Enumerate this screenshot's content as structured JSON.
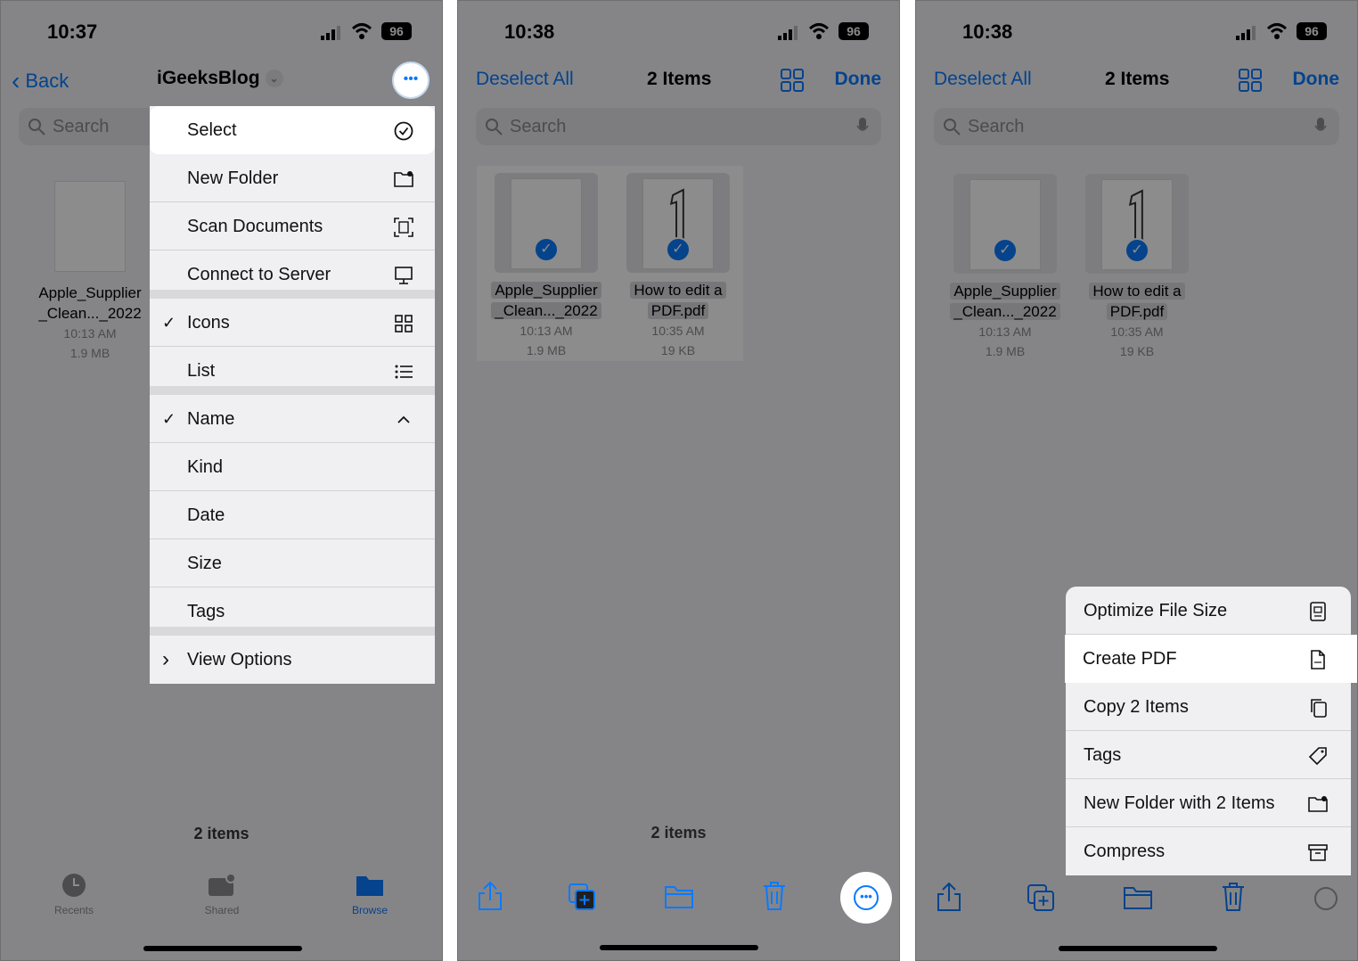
{
  "panel1": {
    "time": "10:37",
    "battery": "96",
    "back_label": "Back",
    "title": "iGeeksBlog",
    "search_placeholder": "Search",
    "file": {
      "name_line1": "Apple_Supplier",
      "name_line2": "_Clean..._2022",
      "time": "10:13 AM",
      "size": "1.9 MB"
    },
    "menu": [
      {
        "label": "Select",
        "icon": "checkmark-circle-icon",
        "checked": false,
        "highlight": true
      },
      {
        "label": "New Folder",
        "icon": "folder-plus-icon",
        "checked": false
      },
      {
        "label": "Scan Documents",
        "icon": "scan-icon",
        "checked": false
      },
      {
        "label": "Connect to Server",
        "icon": "monitor-icon",
        "checked": false,
        "sep": true
      },
      {
        "label": "Icons",
        "icon": "grid-icon",
        "checked": true
      },
      {
        "label": "List",
        "icon": "list-icon",
        "checked": false,
        "sep": true
      },
      {
        "label": "Name",
        "icon": "chevron-up-icon",
        "checked": true
      },
      {
        "label": "Kind",
        "icon": "",
        "checked": false
      },
      {
        "label": "Date",
        "icon": "",
        "checked": false
      },
      {
        "label": "Size",
        "icon": "",
        "checked": false
      },
      {
        "label": "Tags",
        "icon": "",
        "checked": false,
        "sep": true
      },
      {
        "label": "View Options",
        "icon": "",
        "checked": false,
        "chevron": "›"
      }
    ],
    "items_count": "2 items",
    "tabs": [
      {
        "label": "Recents",
        "icon": "clock-icon"
      },
      {
        "label": "Shared",
        "icon": "shared-folder-icon"
      },
      {
        "label": "Browse",
        "icon": "folder-icon",
        "active": true
      }
    ]
  },
  "panel2": {
    "time": "10:38",
    "battery": "96",
    "deselect_label": "Deselect All",
    "count_label": "2 Items",
    "done_label": "Done",
    "search_placeholder": "Search",
    "files": [
      {
        "name_line1": "Apple_Supplier",
        "name_line2": "_Clean..._2022",
        "time": "10:13 AM",
        "size": "1.9 MB"
      },
      {
        "name_line1": "How to edit a",
        "name_line2": "PDF.pdf",
        "time": "10:35 AM",
        "size": "19 KB"
      }
    ],
    "items_count": "2 items"
  },
  "panel3": {
    "time": "10:38",
    "battery": "96",
    "deselect_label": "Deselect All",
    "count_label": "2 Items",
    "done_label": "Done",
    "search_placeholder": "Search",
    "files": [
      {
        "name_line1": "Apple_Supplier",
        "name_line2": "_Clean..._2022",
        "time": "10:13 AM",
        "size": "1.9 MB"
      },
      {
        "name_line1": "How to edit a",
        "name_line2": "PDF.pdf",
        "time": "10:35 AM",
        "size": "19 KB"
      }
    ],
    "menu": [
      {
        "label": "Optimize File Size",
        "icon": "optimize-icon"
      },
      {
        "label": "Create PDF",
        "icon": "pdf-file-icon",
        "highlight": true
      },
      {
        "label": "Copy 2 Items",
        "icon": "copy-icon"
      },
      {
        "label": "Tags",
        "icon": "tag-icon"
      },
      {
        "label": "New Folder with 2 Items",
        "icon": "folder-plus-icon"
      },
      {
        "label": "Compress",
        "icon": "archive-icon"
      }
    ]
  },
  "colors": {
    "accent": "#0a7aff",
    "background": "#f2f2f7"
  }
}
